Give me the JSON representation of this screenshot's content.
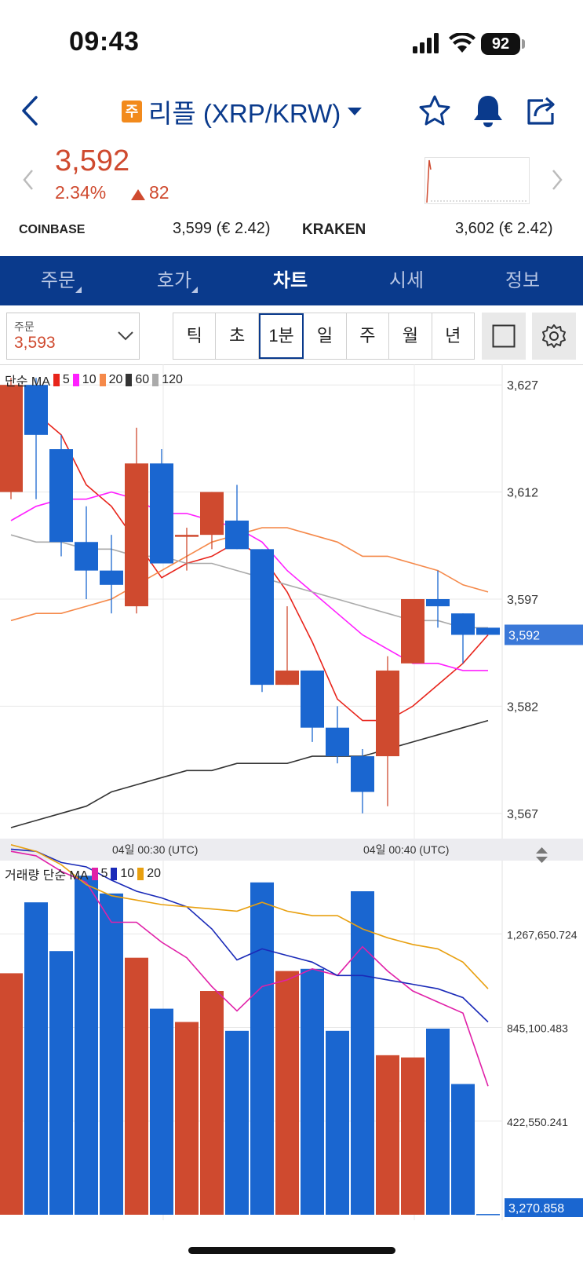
{
  "status_bar": {
    "time": "09:43",
    "battery": "92"
  },
  "header": {
    "badge": "주",
    "title": "리플 (XRP/KRW)",
    "icons": [
      "back-icon",
      "caret-down-icon",
      "star-icon",
      "bell-icon",
      "share-icon"
    ]
  },
  "price": {
    "current": "3,592",
    "change_pct": "2.34%",
    "change_abs": "82"
  },
  "exchanges": [
    {
      "name": "COINBASE",
      "value": "3,599 (€ 2.42)"
    },
    {
      "name": "KRAKEN",
      "value": "3,602 (€ 2.42)"
    }
  ],
  "tabs": [
    {
      "label": "주문",
      "has_caret": true
    },
    {
      "label": "호가",
      "has_caret": true
    },
    {
      "label": "차트",
      "active": true
    },
    {
      "label": "시세"
    },
    {
      "label": "정보"
    }
  ],
  "order_select": {
    "label": "주문",
    "value": "3,593"
  },
  "periods": [
    "틱",
    "초",
    "1분",
    "일",
    "주",
    "월",
    "년"
  ],
  "active_period": "1분",
  "price_legend": {
    "label": "단순 MA",
    "items": [
      {
        "period": "5",
        "color": "#e8241b"
      },
      {
        "period": "10",
        "color": "#ff20ff"
      },
      {
        "period": "20",
        "color": "#f5894a"
      },
      {
        "period": "60",
        "color": "#333333"
      },
      {
        "period": "120",
        "color": "#aaaaaa"
      }
    ]
  },
  "volume_legend": {
    "label": "거래량 단순 MA",
    "items": [
      {
        "period": "5",
        "color": "#e020a8"
      },
      {
        "period": "10",
        "color": "#1a2ab8"
      },
      {
        "period": "20",
        "color": "#e8a010"
      }
    ]
  },
  "colors": {
    "up": "#cf4a2f",
    "down": "#1a66d0",
    "brand": "#0a3a8c",
    "badge": "#f28a1c"
  },
  "chart_data": [
    {
      "type": "candlestick",
      "title": "",
      "x_tick_labels": [
        "04일 00:30 (UTC)",
        "04일 00:40 (UTC)"
      ],
      "y_tick_labels": [
        "3,627",
        "3,612",
        "3,597",
        "3,582",
        "3,567"
      ],
      "ylim": [
        3565,
        3629
      ],
      "current_price_label": "3,592",
      "candles": [
        {
          "o": 3612,
          "h": 3628,
          "l": 3611,
          "c": 3627
        },
        {
          "o": 3627,
          "h": 3628,
          "l": 3611,
          "c": 3620
        },
        {
          "o": 3618,
          "h": 3620,
          "l": 3603,
          "c": 3605
        },
        {
          "o": 3605,
          "h": 3610,
          "l": 3597,
          "c": 3601
        },
        {
          "o": 3601,
          "h": 3606,
          "l": 3595,
          "c": 3599
        },
        {
          "o": 3596,
          "h": 3621,
          "l": 3595,
          "c": 3616
        },
        {
          "o": 3616,
          "h": 3618,
          "l": 3603,
          "c": 3602
        },
        {
          "o": 3606,
          "h": 3607,
          "l": 3601,
          "c": 3606
        },
        {
          "o": 3606,
          "h": 3612,
          "l": 3604,
          "c": 3612
        },
        {
          "o": 3608,
          "h": 3613,
          "l": 3604,
          "c": 3604
        },
        {
          "o": 3604,
          "h": 3604,
          "l": 3584,
          "c": 3585
        },
        {
          "o": 3585,
          "h": 3596,
          "l": 3585,
          "c": 3587
        },
        {
          "o": 3587,
          "h": 3587,
          "l": 3577,
          "c": 3579
        },
        {
          "o": 3579,
          "h": 3582,
          "l": 3574,
          "c": 3575
        },
        {
          "o": 3575,
          "h": 3576,
          "l": 3567,
          "c": 3570
        },
        {
          "o": 3575,
          "h": 3589,
          "l": 3568,
          "c": 3587
        },
        {
          "o": 3588,
          "h": 3597,
          "l": 3588,
          "c": 3597
        },
        {
          "o": 3597,
          "h": 3601,
          "l": 3593,
          "c": 3596
        },
        {
          "o": 3595,
          "h": 3595,
          "l": 3588,
          "c": 3592
        },
        {
          "o": 3593,
          "h": 3593,
          "l": 3593,
          "c": 3592
        }
      ],
      "ma": [
        {
          "name": "5",
          "color": "#e8241b",
          "values": [
            null,
            3623,
            3620,
            3613,
            3610,
            3605,
            3600,
            3602,
            3603,
            3605,
            3603,
            3598,
            3591,
            3583,
            3580,
            3580,
            3582,
            3585,
            3588,
            3592
          ]
        },
        {
          "name": "10",
          "color": "#ff20ff",
          "values": [
            3608,
            3610,
            3611,
            3611,
            3612,
            3611,
            3609,
            3609,
            3608,
            3607,
            3605,
            3601,
            3598,
            3595,
            3592,
            3590,
            3588,
            3588,
            3587,
            3587
          ]
        },
        {
          "name": "20",
          "color": "#f5894a",
          "values": [
            3594,
            3595,
            3595,
            3596,
            3597,
            3599,
            3601,
            3603,
            3605,
            3606,
            3607,
            3607,
            3606,
            3605,
            3603,
            3603,
            3602,
            3601,
            3599,
            3598
          ]
        },
        {
          "name": "60",
          "color": "#333333",
          "values": [
            3565,
            3566,
            3567,
            3568,
            3570,
            3571,
            3572,
            3573,
            3573,
            3574,
            3574,
            3574,
            3575,
            3575,
            3575,
            3576,
            3577,
            3578,
            3579,
            3580
          ]
        },
        {
          "name": "120",
          "color": "#aaaaaa",
          "values": [
            3606,
            3605,
            3605,
            3604,
            3604,
            3603,
            3603,
            3602,
            3602,
            3601,
            3600,
            3599,
            3598,
            3597,
            3596,
            3595,
            3594,
            3594,
            3593,
            3593
          ]
        }
      ]
    },
    {
      "type": "bar",
      "title": "",
      "y_tick_labels": [
        "1,267,650.724",
        "845,100.483",
        "422,550.241"
      ],
      "current_value_label": "3,270.858",
      "ylim": [
        0,
        1570000
      ],
      "bars": [
        {
          "v": 1090000,
          "dir": "up"
        },
        {
          "v": 1410000,
          "dir": "down"
        },
        {
          "v": 1190000,
          "dir": "down"
        },
        {
          "v": 1530000,
          "dir": "down"
        },
        {
          "v": 1450000,
          "dir": "down"
        },
        {
          "v": 1160000,
          "dir": "up"
        },
        {
          "v": 930000,
          "dir": "down"
        },
        {
          "v": 870000,
          "dir": "up"
        },
        {
          "v": 1010000,
          "dir": "up"
        },
        {
          "v": 830000,
          "dir": "down"
        },
        {
          "v": 1500000,
          "dir": "down"
        },
        {
          "v": 1100000,
          "dir": "up"
        },
        {
          "v": 1110000,
          "dir": "down"
        },
        {
          "v": 830000,
          "dir": "down"
        },
        {
          "v": 1460000,
          "dir": "down"
        },
        {
          "v": 720000,
          "dir": "up"
        },
        {
          "v": 710000,
          "dir": "up"
        },
        {
          "v": 840000,
          "dir": "down"
        },
        {
          "v": 590000,
          "dir": "down"
        },
        {
          "v": 3270,
          "dir": "down"
        }
      ],
      "ma": [
        {
          "name": "5",
          "color": "#e020a8",
          "values": [
            1640000,
            1620000,
            1550000,
            1500000,
            1320000,
            1320000,
            1230000,
            1160000,
            1030000,
            920000,
            1030000,
            1060000,
            1110000,
            1080000,
            1210000,
            1100000,
            1010000,
            960000,
            910000,
            580000
          ]
        },
        {
          "name": "10",
          "color": "#1a2ab8",
          "values": [
            1650000,
            1640000,
            1590000,
            1570000,
            1510000,
            1460000,
            1430000,
            1390000,
            1290000,
            1150000,
            1200000,
            1170000,
            1140000,
            1080000,
            1080000,
            1060000,
            1040000,
            1020000,
            980000,
            870000
          ]
        },
        {
          "name": "20",
          "color": "#e8a010",
          "values": [
            1670000,
            1640000,
            1580000,
            1490000,
            1440000,
            1420000,
            1400000,
            1390000,
            1380000,
            1370000,
            1410000,
            1370000,
            1350000,
            1350000,
            1290000,
            1250000,
            1220000,
            1200000,
            1140000,
            1020000
          ]
        }
      ]
    }
  ]
}
